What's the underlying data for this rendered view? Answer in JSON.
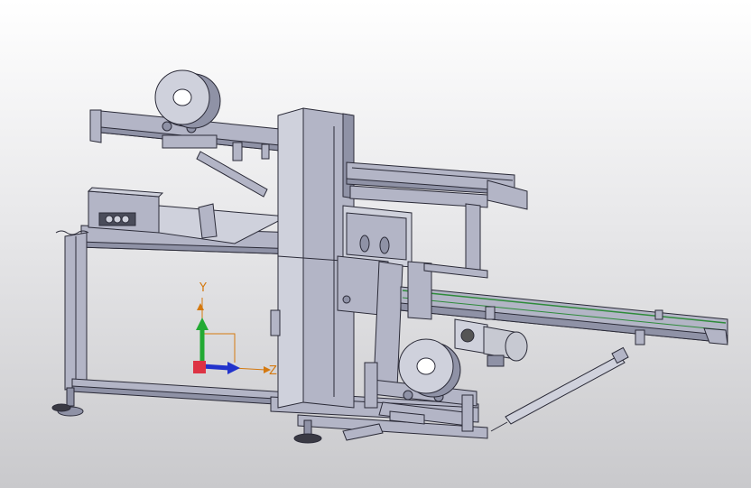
{
  "viewport": {
    "background_top": "#ffffff",
    "background_bottom": "#c9c9cc"
  },
  "model": {
    "body_color": "#b3b5c6",
    "edge_color": "#2b2b38",
    "belt_accent_color": "#2e8b3a",
    "motor_color": "#c7c9d2"
  },
  "triad": {
    "y_label": "Y",
    "z_label": "Z",
    "y_color": "#22aa33",
    "z_color": "#2233cc",
    "x_color": "#dd3344",
    "label_color": "#d4790f"
  }
}
